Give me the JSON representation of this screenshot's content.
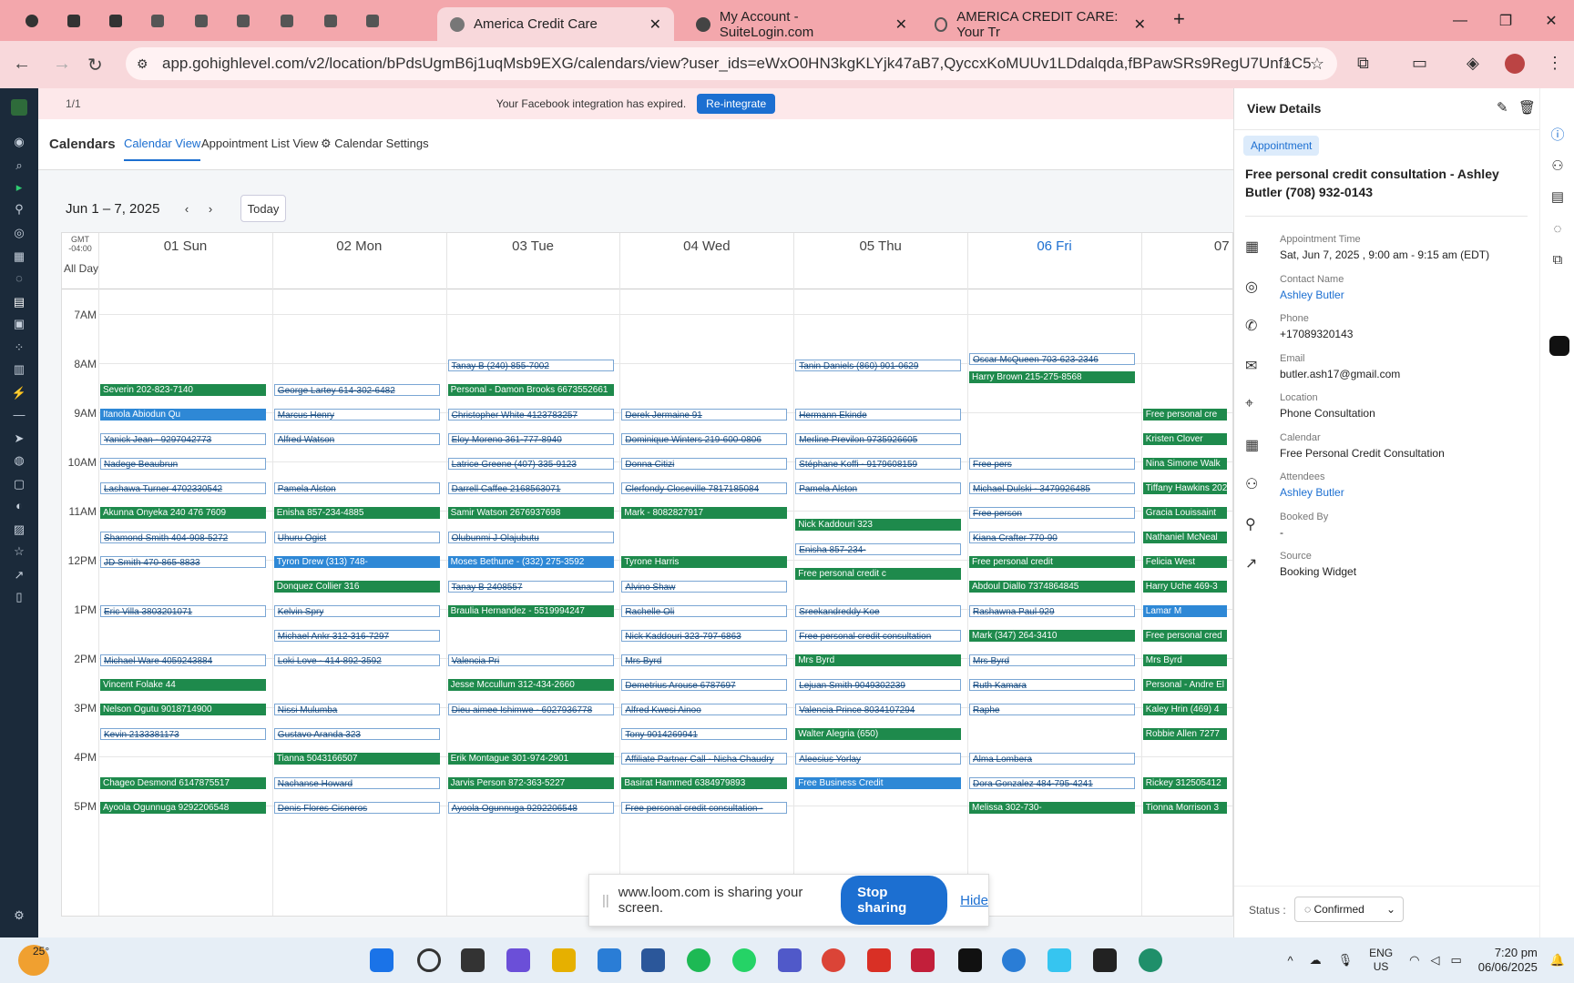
{
  "browser": {
    "tabs": [
      {
        "title": "America Credit Care",
        "active": true
      },
      {
        "title": "My Account - SuiteLogin.com",
        "active": false
      },
      {
        "title": "AMERICA CREDIT CARE: Your Tr",
        "active": false
      }
    ],
    "url": "app.gohighlevel.com/v2/location/bPdsUgmB6j1uqMsb9EXG/calendars/view?user_ids=eWxO0HN3kgKLYjk47aB7,QyccxKoMUUv1LDdalqda,fBPawSRs9RegU7Unf1C5"
  },
  "banner": {
    "text": "Your Facebook integration has expired.",
    "button": "Re-integrate",
    "pager": "1/1"
  },
  "subnav": {
    "title": "Calendars",
    "tabs": [
      "Calendar View",
      "Appointment List View",
      "Calendar Settings"
    ]
  },
  "calendar": {
    "range": "Jun 1 – 7, 2025",
    "today": "Today",
    "tz": "GMT -04:00",
    "allday": "All Day",
    "days": [
      "01 Sun",
      "02 Mon",
      "03 Tue",
      "04 Wed",
      "05 Thu",
      "06 Fri",
      "07 S"
    ],
    "hours": [
      "7AM",
      "8AM",
      "9AM",
      "10AM",
      "11AM",
      "12PM",
      "1PM",
      "2PM",
      "3PM",
      "4PM",
      "5PM"
    ],
    "events": [
      {
        "d": 0,
        "t": 8.42,
        "s": "g",
        "label": "Severin    202-823-7140"
      },
      {
        "d": 0,
        "t": 8.92,
        "s": "b",
        "label": "Itanola Abiodun Qu"
      },
      {
        "d": 0,
        "t": 9.42,
        "s": "o",
        "label": "Yanick Jean - 9297042773"
      },
      {
        "d": 0,
        "t": 9.92,
        "s": "o",
        "label": "Nadege Beaubrun"
      },
      {
        "d": 0,
        "t": 10.42,
        "s": "o",
        "label": "Lashawa Turner 4702330542"
      },
      {
        "d": 0,
        "t": 10.92,
        "s": "g",
        "label": "Akunna Onyeka 240 476 7609"
      },
      {
        "d": 0,
        "t": 11.42,
        "s": "o",
        "label": "Shamond Smith 404-908-5272"
      },
      {
        "d": 0,
        "t": 11.92,
        "s": "o",
        "label": "JD Smith 470-865-8833"
      },
      {
        "d": 0,
        "t": 12.92,
        "s": "o",
        "label": "Eric Villa        3803201071"
      },
      {
        "d": 0,
        "t": 13.92,
        "s": "o",
        "label": "Michael Ware    4059243884"
      },
      {
        "d": 0,
        "t": 14.42,
        "s": "g",
        "label": "Vincent Folake  44"
      },
      {
        "d": 0,
        "t": 14.92,
        "s": "g",
        "label": "Nelson Ogutu  9018714900"
      },
      {
        "d": 0,
        "t": 15.42,
        "s": "o",
        "label": "Kevin 2133381173"
      },
      {
        "d": 0,
        "t": 16.42,
        "s": "g",
        "label": "Chageo Desmond 6147875517"
      },
      {
        "d": 0,
        "t": 16.92,
        "s": "g",
        "label": "Ayoola Ogunnuga 9292206548"
      },
      {
        "d": 1,
        "t": 8.42,
        "s": "o",
        "label": "George Lartey 614-302-6482"
      },
      {
        "d": 1,
        "t": 8.92,
        "s": "o",
        "label": "Marcus Henry"
      },
      {
        "d": 1,
        "t": 9.42,
        "s": "o",
        "label": "Alfred Watson"
      },
      {
        "d": 1,
        "t": 10.42,
        "s": "o",
        "label": "Pamela Alston"
      },
      {
        "d": 1,
        "t": 10.92,
        "s": "g",
        "label": "Enisha  857-234-4885"
      },
      {
        "d": 1,
        "t": 11.42,
        "s": "o",
        "label": "Uhuru Ogist"
      },
      {
        "d": 1,
        "t": 11.92,
        "s": "b",
        "label": "Tyron Drew (313) 748-"
      },
      {
        "d": 1,
        "t": 12.42,
        "s": "g",
        "label": "Donquez Collier  316"
      },
      {
        "d": 1,
        "t": 12.92,
        "s": "o",
        "label": "Kelvin Spry"
      },
      {
        "d": 1,
        "t": 13.42,
        "s": "o",
        "label": "Michael Ankr 312-316-7297"
      },
      {
        "d": 1,
        "t": 13.92,
        "s": "o",
        "label": "Loki Love  - 414-892-3592"
      },
      {
        "d": 1,
        "t": 14.92,
        "s": "o",
        "label": "Nissi Mulumba"
      },
      {
        "d": 1,
        "t": 15.42,
        "s": "o",
        "label": "Gustavo Aranda  323"
      },
      {
        "d": 1,
        "t": 15.92,
        "s": "g",
        "label": "Tianna    5043166507"
      },
      {
        "d": 1,
        "t": 16.42,
        "s": "o",
        "label": "Nachanse Howard"
      },
      {
        "d": 1,
        "t": 16.92,
        "s": "o",
        "label": "Denis Flores Cisneros"
      },
      {
        "d": 2,
        "t": 7.92,
        "s": "o",
        "label": "Tanay B  (240) 855-7002"
      },
      {
        "d": 2,
        "t": 8.42,
        "s": "g",
        "label": "Personal - Damon Brooks 6673552661"
      },
      {
        "d": 2,
        "t": 8.92,
        "s": "o",
        "label": "Christopher White 4123783257"
      },
      {
        "d": 2,
        "t": 9.42,
        "s": "o",
        "label": "Eloy Moreno   361-777-8940"
      },
      {
        "d": 2,
        "t": 9.92,
        "s": "o",
        "label": "Latrice Greene  (407) 335-9123"
      },
      {
        "d": 2,
        "t": 10.42,
        "s": "o",
        "label": "Darrell Caffee 2168563071"
      },
      {
        "d": 2,
        "t": 10.92,
        "s": "g",
        "label": "Samir Watson   2676937698"
      },
      {
        "d": 2,
        "t": 11.42,
        "s": "o",
        "label": "Olubunmi J Olajubutu"
      },
      {
        "d": 2,
        "t": 11.92,
        "s": "b",
        "label": "Moses Bethune - (332) 275-3592"
      },
      {
        "d": 2,
        "t": 12.42,
        "s": "o",
        "label": "Tanay B  2408557"
      },
      {
        "d": 2,
        "t": 12.92,
        "s": "g",
        "label": "Braulia Hernandez - 5519994247"
      },
      {
        "d": 2,
        "t": 13.92,
        "s": "o",
        "label": "Valencia Pri"
      },
      {
        "d": 2,
        "t": 14.42,
        "s": "g",
        "label": "Jesse Mccullum  312-434-2660"
      },
      {
        "d": 2,
        "t": 14.92,
        "s": "o",
        "label": "Dieu aimee Ishimwe - 6027936778"
      },
      {
        "d": 2,
        "t": 15.92,
        "s": "g",
        "label": "Erik Montague 301-974-2901"
      },
      {
        "d": 2,
        "t": 16.42,
        "s": "g",
        "label": "Jarvis Person 872-363-5227"
      },
      {
        "d": 2,
        "t": 16.92,
        "s": "o",
        "label": "Ayoola Ogunnuga 9292206548"
      },
      {
        "d": 3,
        "t": 8.92,
        "s": "o",
        "label": "Derek Jermaine 91"
      },
      {
        "d": 3,
        "t": 9.42,
        "s": "o",
        "label": "Dominique Winters  219-600-0806"
      },
      {
        "d": 3,
        "t": 9.92,
        "s": "o",
        "label": "Donna Citizi"
      },
      {
        "d": 3,
        "t": 10.42,
        "s": "o",
        "label": "Clerfondy Closeville 7817185084"
      },
      {
        "d": 3,
        "t": 10.92,
        "s": "g",
        "label": "Mark - 8082827917"
      },
      {
        "d": 3,
        "t": 11.92,
        "s": "g",
        "label": "Tyrone Harris"
      },
      {
        "d": 3,
        "t": 12.42,
        "s": "o",
        "label": "Alvino Shaw"
      },
      {
        "d": 3,
        "t": 12.92,
        "s": "o",
        "label": "Rachelle Oli"
      },
      {
        "d": 3,
        "t": 13.42,
        "s": "o",
        "label": "Nick Kaddouri 323-797-6863"
      },
      {
        "d": 3,
        "t": 13.92,
        "s": "o",
        "label": "Mrs Byrd"
      },
      {
        "d": 3,
        "t": 14.42,
        "s": "o",
        "label": "Demetrius Arouse 6787697"
      },
      {
        "d": 3,
        "t": 14.92,
        "s": "o",
        "label": "Alfred Kwesi Ainoo"
      },
      {
        "d": 3,
        "t": 15.42,
        "s": "o",
        "label": "Tony  9014269941"
      },
      {
        "d": 3,
        "t": 15.92,
        "s": "o",
        "label": "Affiliate Partner Call - Nisha Chaudry"
      },
      {
        "d": 3,
        "t": 16.42,
        "s": "g",
        "label": "Basirat Hammed  6384979893"
      },
      {
        "d": 3,
        "t": 16.92,
        "s": "o",
        "label": "Free personal credit consultation -"
      },
      {
        "d": 4,
        "t": 7.92,
        "s": "o",
        "label": "Tanin Daniels (860) 901-0629"
      },
      {
        "d": 4,
        "t": 8.92,
        "s": "o",
        "label": "Hermann Ekinde"
      },
      {
        "d": 4,
        "t": 9.42,
        "s": "o",
        "label": "Merline Previlon   9735926605"
      },
      {
        "d": 4,
        "t": 9.92,
        "s": "o",
        "label": "Stéphane Koffi - 9179608159"
      },
      {
        "d": 4,
        "t": 10.42,
        "s": "o",
        "label": "Pamela Alston"
      },
      {
        "d": 4,
        "t": 11.17,
        "s": "g",
        "label": "Nick Kaddouri    323"
      },
      {
        "d": 4,
        "t": 11.67,
        "s": "o",
        "label": "Enisha   857-234-"
      },
      {
        "d": 4,
        "t": 12.17,
        "s": "g",
        "label": "Free personal credit c"
      },
      {
        "d": 4,
        "t": 12.92,
        "s": "o",
        "label": "Sreekandreddy Koe"
      },
      {
        "d": 4,
        "t": 13.42,
        "s": "o",
        "label": "Free personal credit consultation"
      },
      {
        "d": 4,
        "t": 13.92,
        "s": "g",
        "label": "Mrs Byrd"
      },
      {
        "d": 4,
        "t": 14.42,
        "s": "o",
        "label": "Lejuan Smith  9049302239"
      },
      {
        "d": 4,
        "t": 14.92,
        "s": "o",
        "label": "Valencia Prince 8034107294"
      },
      {
        "d": 4,
        "t": 15.42,
        "s": "g",
        "label": "Walter Alegria (650)"
      },
      {
        "d": 4,
        "t": 15.92,
        "s": "o",
        "label": "Aleesius Yorlay"
      },
      {
        "d": 4,
        "t": 16.42,
        "s": "b",
        "label": "Free Business Credit"
      },
      {
        "d": 5,
        "t": 7.8,
        "s": "o",
        "label": "Oscar McQueen 703-623-2346"
      },
      {
        "d": 5,
        "t": 8.17,
        "s": "g",
        "label": "Harry Brown 215-275-8568"
      },
      {
        "d": 5,
        "t": 9.92,
        "s": "o",
        "label": "Free pers"
      },
      {
        "d": 5,
        "t": 10.42,
        "s": "o",
        "label": "Michael Dulski - 3479926485"
      },
      {
        "d": 5,
        "t": 10.92,
        "s": "o",
        "label": "Free person"
      },
      {
        "d": 5,
        "t": 11.42,
        "s": "o",
        "label": "Kiana Crafter  770-90"
      },
      {
        "d": 5,
        "t": 11.92,
        "s": "g",
        "label": "Free personal credit"
      },
      {
        "d": 5,
        "t": 12.42,
        "s": "g",
        "label": "Abdoul Diallo  7374864845"
      },
      {
        "d": 5,
        "t": 12.92,
        "s": "o",
        "label": "Rashawna Paul 929"
      },
      {
        "d": 5,
        "t": 13.42,
        "s": "g",
        "label": "Mark  (347) 264-3410"
      },
      {
        "d": 5,
        "t": 13.92,
        "s": "o",
        "label": "Mrs Byrd"
      },
      {
        "d": 5,
        "t": 14.42,
        "s": "o",
        "label": "Ruth Kamara"
      },
      {
        "d": 5,
        "t": 14.92,
        "s": "o",
        "label": "Raphe"
      },
      {
        "d": 5,
        "t": 15.92,
        "s": "o",
        "label": "Alma  Lombera"
      },
      {
        "d": 5,
        "t": 16.42,
        "s": "o",
        "label": "Dora Gonzalez  484-795-4241"
      },
      {
        "d": 5,
        "t": 16.92,
        "s": "g",
        "label": "Melissa    302-730-"
      },
      {
        "d": 6,
        "t": 8.92,
        "s": "g",
        "label": "Free personal cre"
      },
      {
        "d": 6,
        "t": 9.42,
        "s": "g",
        "label": "Kristen Clover"
      },
      {
        "d": 6,
        "t": 9.92,
        "s": "g",
        "label": "Nina Simone Walk"
      },
      {
        "d": 6,
        "t": 10.42,
        "s": "g",
        "label": "Tiffany Hawkins 202"
      },
      {
        "d": 6,
        "t": 10.92,
        "s": "g",
        "label": "Gracia Louissaint"
      },
      {
        "d": 6,
        "t": 11.42,
        "s": "g",
        "label": "Nathaniel McNeal"
      },
      {
        "d": 6,
        "t": 11.92,
        "s": "g",
        "label": "Felicia West"
      },
      {
        "d": 6,
        "t": 12.42,
        "s": "g",
        "label": "Harry Uche  469-3"
      },
      {
        "d": 6,
        "t": 12.92,
        "s": "b",
        "label": "Lamar M"
      },
      {
        "d": 6,
        "t": 13.42,
        "s": "g",
        "label": "Free personal cred"
      },
      {
        "d": 6,
        "t": 13.92,
        "s": "g",
        "label": "Mrs Byrd"
      },
      {
        "d": 6,
        "t": 14.42,
        "s": "g",
        "label": "Personal - Andre El"
      },
      {
        "d": 6,
        "t": 14.92,
        "s": "g",
        "label": "Kaley Hrin  (469) 4"
      },
      {
        "d": 6,
        "t": 15.42,
        "s": "g",
        "label": "Robbie Allen  7277"
      },
      {
        "d": 6,
        "t": 16.42,
        "s": "g",
        "label": "Rickey  312505412"
      },
      {
        "d": 6,
        "t": 16.92,
        "s": "g",
        "label": "Tionna Morrison  3"
      }
    ]
  },
  "details": {
    "header": "View Details",
    "badge": "Appointment",
    "title": "Free personal credit consultation - Ashley Butler (708) 932-0143",
    "rows": [
      {
        "label": "Appointment Time",
        "value": "Sat, Jun 7, 2025 , 9:00 am - 9:15 am (EDT)",
        "link": false
      },
      {
        "label": "Contact Name",
        "value": "Ashley Butler",
        "link": true
      },
      {
        "label": "Phone",
        "value": "+17089320143",
        "link": false
      },
      {
        "label": "Email",
        "value": "butler.ash17@gmail.com",
        "link": false
      },
      {
        "label": "Location",
        "value": "Phone Consultation",
        "link": false
      },
      {
        "label": "Calendar",
        "value": "Free Personal Credit Consultation",
        "link": false
      },
      {
        "label": "Attendees",
        "value": "Ashley Butler",
        "link": true
      },
      {
        "label": "Booked By",
        "value": "-",
        "link": false
      },
      {
        "label": "Source",
        "value": "Booking Widget",
        "link": false
      }
    ],
    "status_label": "Status :",
    "status_value": "Confirmed"
  },
  "loom": {
    "text": "www.loom.com is sharing your screen.",
    "stop": "Stop sharing",
    "hide": "Hide"
  },
  "taskbar": {
    "weather": "25°",
    "lang1": "ENG",
    "lang2": "US",
    "time": "7:20 pm",
    "date": "06/06/2025"
  }
}
